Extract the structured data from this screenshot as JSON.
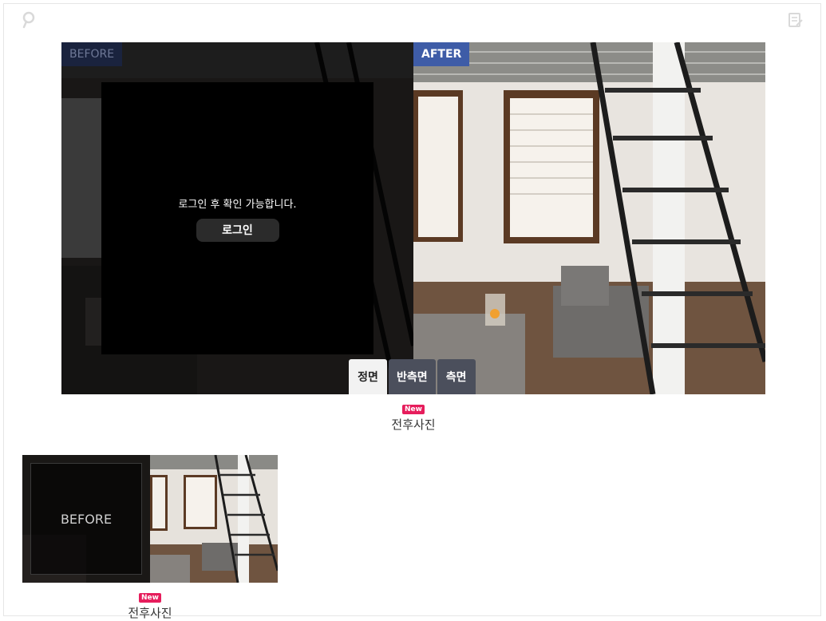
{
  "viewer": {
    "before_label": "BEFORE",
    "after_label": "AFTER",
    "login_message": "로그인 후 확인 가능합니다.",
    "login_button": "로그인",
    "angle_tabs": [
      {
        "label": "정면",
        "active": true
      },
      {
        "label": "반측면",
        "active": false
      },
      {
        "label": "측면",
        "active": false
      }
    ]
  },
  "main_caption": {
    "badge": "New",
    "title": "전후사진"
  },
  "thumbnail": {
    "before_label": "BEFORE"
  },
  "thumb_caption": {
    "badge": "New",
    "title": "전후사진"
  },
  "icons": {
    "left": "search-icon",
    "right": "memo-icon"
  }
}
